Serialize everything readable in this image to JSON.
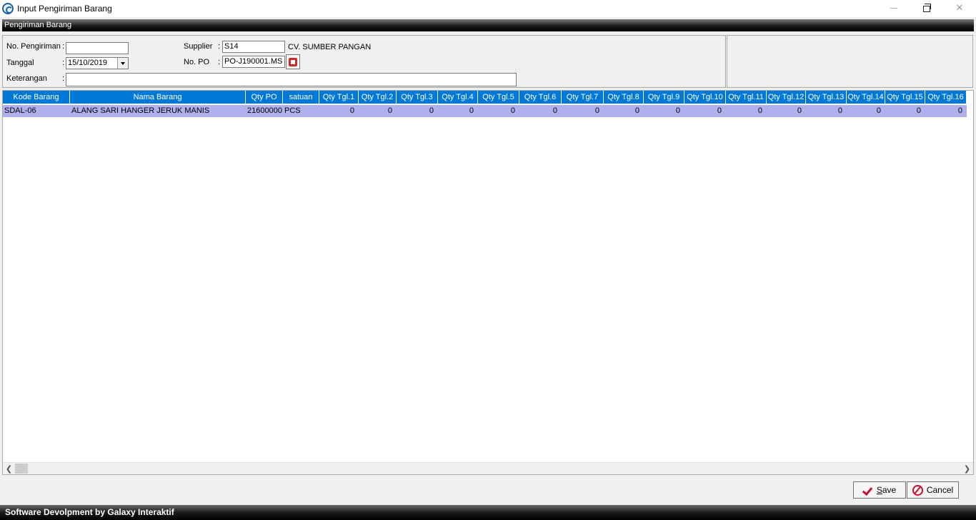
{
  "window": {
    "title": "Input Pengiriman Barang"
  },
  "section": {
    "header": "Pengiriman Barang"
  },
  "form": {
    "no_pengiriman_label": "No. Pengiriman",
    "no_pengiriman_value": "",
    "tanggal_label": "Tanggal",
    "tanggal_value": "15/10/2019",
    "keterangan_label": "Keterangan",
    "keterangan_value": "",
    "supplier_label": "Supplier",
    "supplier_code": "S14",
    "supplier_name": "CV. SUMBER PANGAN",
    "no_po_label": "No. PO",
    "no_po_value": "PO-J190001.MS",
    "colon": ":"
  },
  "grid": {
    "columns": [
      "Kode Barang",
      "Nama Barang",
      "Qty PO",
      "satuan",
      "Qty Tgl.1",
      "Qty Tgl.2",
      "Qty Tgl.3",
      "Qty Tgl.4",
      "Qty Tgl.5",
      "Qty Tgl.6",
      "Qty Tgl.7",
      "Qty Tgl.8",
      "Qty Tgl.9",
      "Qty Tgl.10",
      "Qty Tgl.11",
      "Qty Tgl.12",
      "Qty Tgl.13",
      "Qty Tgl.14",
      "Qty Tgl.15",
      "Qty Tgl.16"
    ],
    "rows": [
      {
        "kode": "SDAL-06",
        "nama": "ALANG SARI HANGER JERUK MANIS",
        "qty_po": "21600000",
        "satuan": "PCS",
        "qty": [
          "0",
          "0",
          "0",
          "0",
          "0",
          "0",
          "0",
          "0",
          "0",
          "0",
          "0",
          "0",
          "0",
          "0",
          "0",
          "0"
        ]
      }
    ]
  },
  "buttons": {
    "save_prefix": "",
    "save_underlined": "S",
    "save_rest": "ave",
    "cancel_label": "Cancel"
  },
  "footer": {
    "text": "Software Devolpment by Galaxy Interaktif"
  },
  "icons": {
    "app": "app-logo-icon",
    "lookup": "lookup-icon",
    "save": "checkmark-icon",
    "cancel": "cancel-icon"
  },
  "colors": {
    "header_bg": "#0078d7",
    "selected_row": "#b0b0ee",
    "accent_red": "#c8102e"
  }
}
